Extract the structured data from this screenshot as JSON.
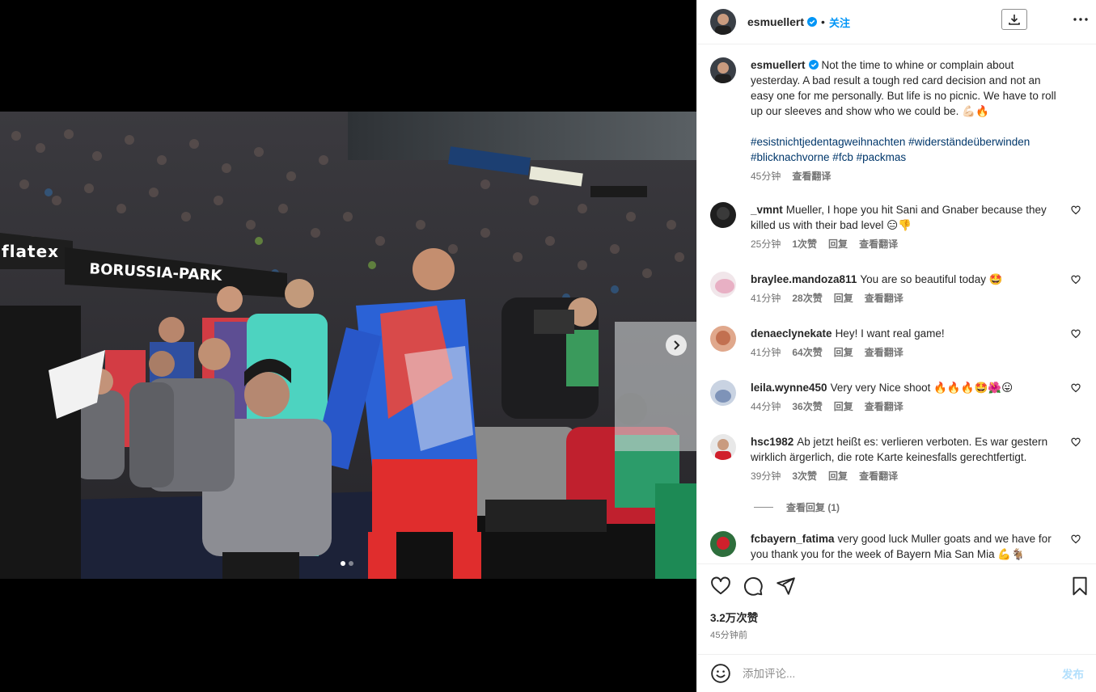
{
  "post": {
    "author": "esmuellert",
    "follow_label": "关注",
    "separator": "•",
    "header_icons": {
      "download": "download-icon",
      "more": "more-horizontal-icon"
    },
    "caption": {
      "text": "Not the time to whine or complain about yesterday. A bad result a tough red card decision and not an easy one for me personally. But life is no picnic. We have to roll up our sleeves and show who we could be. 💪🏻🔥",
      "hashtags": "#esistnichtjedentagweihnachten #widerständeüberwinden #blicknachvorne #fcb #packmas",
      "time": "45分钟",
      "translate": "查看翻译"
    },
    "likes": "3.2万次赞",
    "posted_time": "45分钟前",
    "carousel": {
      "total": 2,
      "current": 1
    },
    "photo_signs": {
      "stadium": "BORUSSIA-PARK",
      "sponsor": "flatex"
    }
  },
  "comments": [
    {
      "user": "_vmnt",
      "text": "Mueller, I hope you hit Sani and Gnaber because they killed us with their bad level 😑👎",
      "time": "25分钟",
      "likes": "1次赞",
      "reply": "回复",
      "translate": "查看翻译"
    },
    {
      "user": "braylee.mandoza811",
      "text": "You are so beautiful today 🤩",
      "time": "41分钟",
      "likes": "28次赞",
      "reply": "回复",
      "translate": "查看翻译"
    },
    {
      "user": "denaeclynekate",
      "text": "Hey! I want real game!",
      "time": "41分钟",
      "likes": "64次赞",
      "reply": "回复",
      "translate": "查看翻译"
    },
    {
      "user": "leila.wynne450",
      "text": "Very very Nice shoot 🔥🔥🔥🤩🌺😛",
      "time": "44分钟",
      "likes": "36次赞",
      "reply": "回复",
      "translate": "查看翻译"
    },
    {
      "user": "hsc1982",
      "text": "Ab jetzt heißt es: verlieren verboten. Es war gestern wirklich ärgerlich, die rote Karte keinesfalls gerechtfertigt.",
      "time": "39分钟",
      "likes": "3次赞",
      "reply": "回复",
      "translate": "查看翻译"
    },
    {
      "user": "fcbayern_fatima",
      "text": "very good luck Muller goats and we have for you thank you for the week of Bayern Mia San Mia 💪🐐",
      "time": "",
      "likes": "",
      "reply": "",
      "translate": ""
    }
  ],
  "view_replies": "查看回复 (1)",
  "composer": {
    "placeholder": "添加评论...",
    "post_label": "发布"
  },
  "colors": {
    "accent": "#0095f6",
    "link": "#00376b",
    "muted": "#737373"
  }
}
